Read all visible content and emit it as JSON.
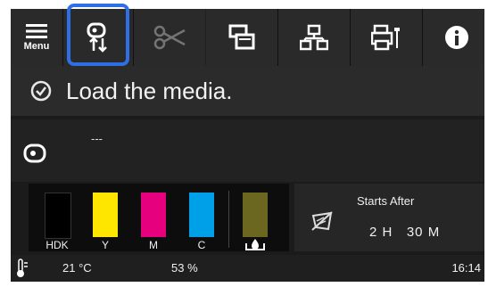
{
  "toolbar": {
    "menu_label": "Menu",
    "buttons": [
      "menu-button",
      "media-feed-button",
      "cut-button",
      "print-queue-button",
      "network-button",
      "maintenance-button",
      "info-button"
    ]
  },
  "status": {
    "message": "Load the media.",
    "icon": "check-circle-icon"
  },
  "media": {
    "info": "---",
    "icon": "roll-media-icon"
  },
  "inks": [
    {
      "label": "HDK",
      "color": "#000000",
      "level": 1.0
    },
    {
      "label": "Y",
      "color": "#ffe600",
      "level": 1.0
    },
    {
      "label": "M",
      "color": "#e6007e",
      "level": 1.0
    },
    {
      "label": "C",
      "color": "#00a0e9",
      "level": 1.0
    },
    {
      "label": "",
      "color": "#6b6620",
      "level": 1.0,
      "icon": "maintenance-box-icon"
    }
  ],
  "timer": {
    "label": "Starts After",
    "value": "2 H   30 M",
    "icon": "cleaning-off-icon"
  },
  "footer": {
    "temperature": "21 °C",
    "humidity": "53 %",
    "time": "16:14"
  }
}
